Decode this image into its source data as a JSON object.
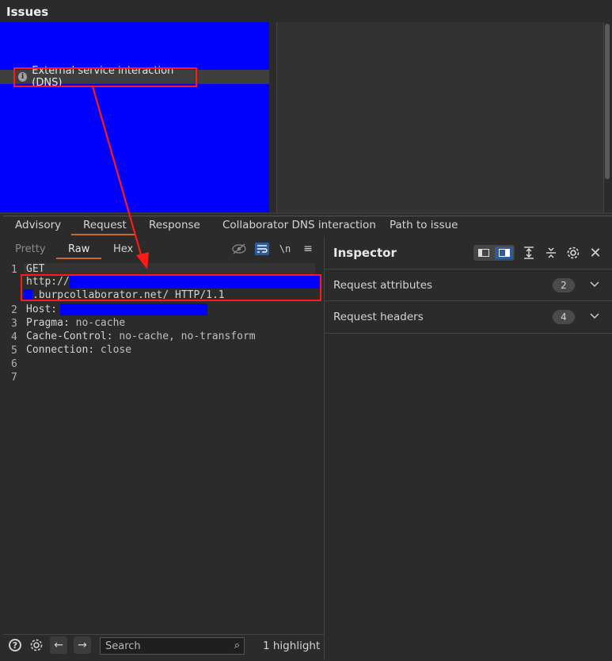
{
  "issues": {
    "title": "Issues",
    "selected_issue": "External service interaction (DNS)"
  },
  "tabs": [
    "Advisory",
    "Request",
    "Response",
    "Collaborator DNS interaction",
    "Path to issue"
  ],
  "active_tab": "Request",
  "view_tabs": [
    "Pretty",
    "Raw",
    "Hex"
  ],
  "active_view": "Raw",
  "editor_tools": {
    "newline_label": "\\n"
  },
  "request": {
    "line_numbers": [
      "1",
      "2",
      "3",
      "4",
      "5",
      "6",
      "7"
    ],
    "method": "GET",
    "url_scheme": "http://",
    "url_rest": ".burpcollaborator.net/ HTTP/1.1",
    "headers": [
      {
        "name": "Host:",
        "value": ""
      },
      {
        "name": "Pragma:",
        "value": " no-cache"
      },
      {
        "name": "Cache-Control:",
        "value": " no-cache, no-transform"
      },
      {
        "name": "Connection:",
        "value": " close"
      }
    ]
  },
  "bottom_bar": {
    "search_placeholder": "Search",
    "highlight_count": "1 highlight"
  },
  "inspector": {
    "title": "Inspector",
    "sections": [
      {
        "label": "Request attributes",
        "count": "2"
      },
      {
        "label": "Request headers",
        "count": "4"
      }
    ]
  },
  "colors": {
    "accent": "#c96a2c",
    "redaction": "#0000ff",
    "annotation": "#ff1a1a",
    "selected_tool": "#2e5a9e"
  }
}
